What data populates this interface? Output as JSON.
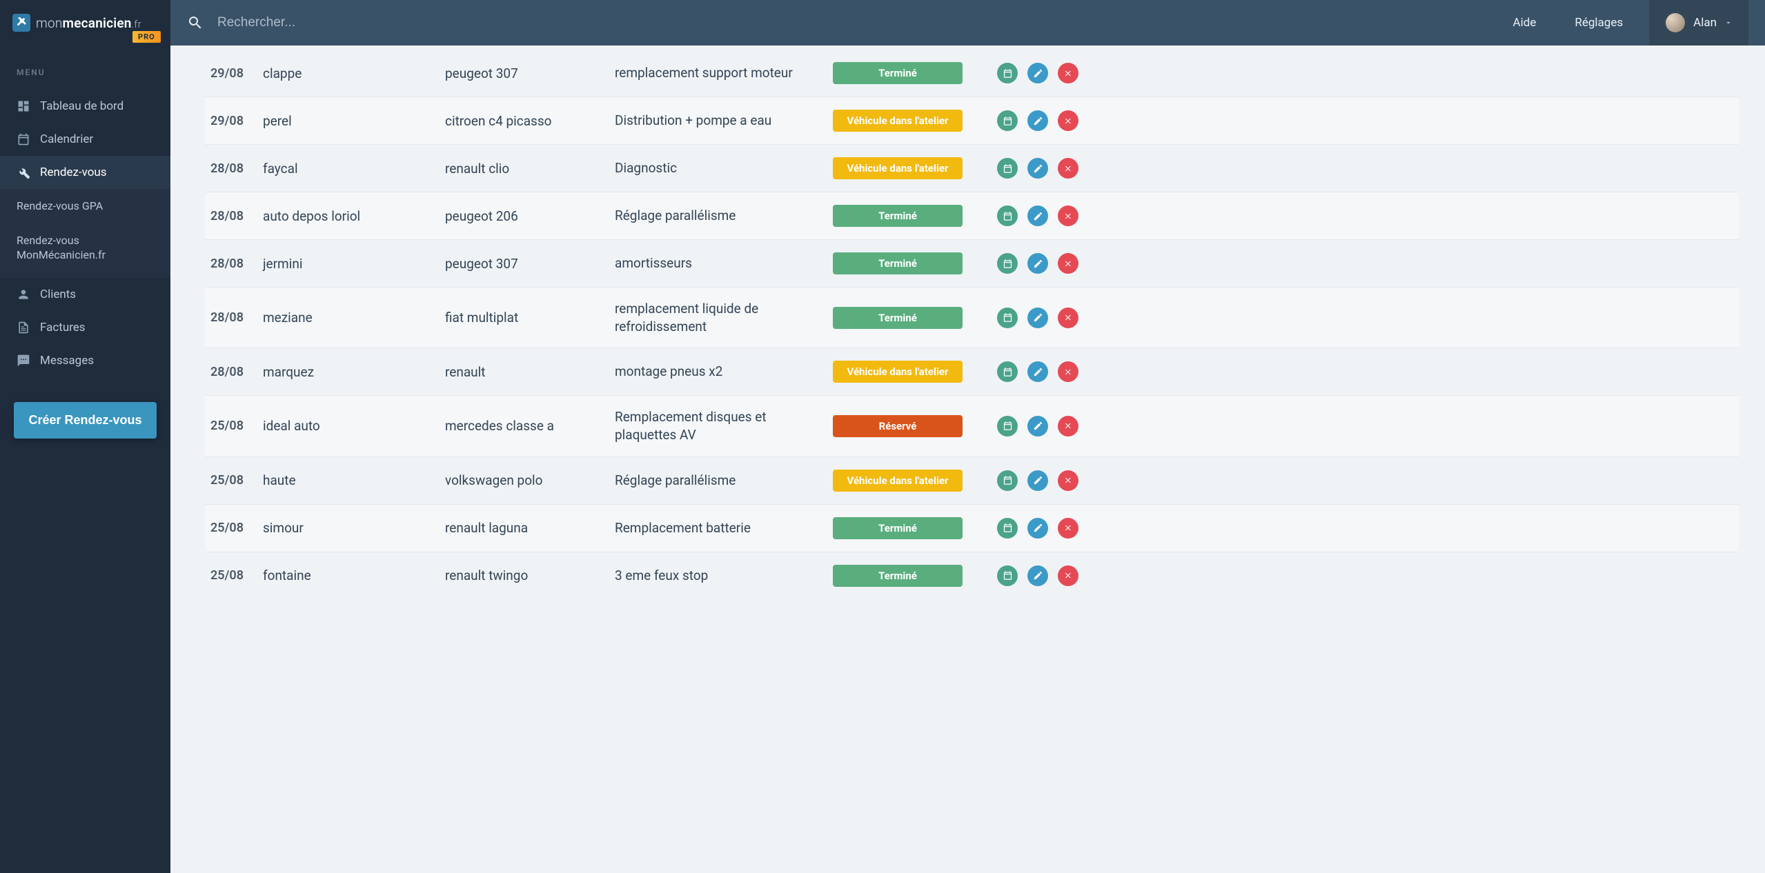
{
  "brand": {
    "mon": "mon",
    "mec": "mecanicien",
    "tld": ".fr",
    "pro": "PRO"
  },
  "sidebar": {
    "menu_label": "MENU",
    "items": [
      {
        "label": "Tableau de bord",
        "icon": "dashboard"
      },
      {
        "label": "Calendrier",
        "icon": "calendar"
      },
      {
        "label": "Rendez-vous",
        "icon": "wrench"
      },
      {
        "label": "Clients",
        "icon": "person"
      },
      {
        "label": "Factures",
        "icon": "file"
      },
      {
        "label": "Messages",
        "icon": "chat"
      }
    ],
    "subitems": [
      {
        "label": "Rendez-vous GPA"
      },
      {
        "label": "Rendez-vous MonMécanicien.fr"
      }
    ],
    "cta": "Créer Rendez-vous"
  },
  "header": {
    "search_placeholder": "Rechercher...",
    "links": [
      "Aide",
      "Réglages"
    ],
    "user": "Alan"
  },
  "status_labels": {
    "green": "Terminé",
    "yellow": "Véhicule dans l'atelier",
    "orange": "Réservé"
  },
  "rows": [
    {
      "date": "29/08",
      "name": "clappe",
      "vehicle": "peugeot 307",
      "desc": "remplacement support moteur",
      "status": "green"
    },
    {
      "date": "29/08",
      "name": "perel",
      "vehicle": "citroen c4 picasso",
      "desc": "Distribution + pompe a eau",
      "status": "yellow"
    },
    {
      "date": "28/08",
      "name": "faycal",
      "vehicle": "renault clio",
      "desc": "Diagnostic",
      "status": "yellow"
    },
    {
      "date": "28/08",
      "name": "auto depos loriol",
      "vehicle": "peugeot 206",
      "desc": "Réglage parallélisme",
      "status": "green"
    },
    {
      "date": "28/08",
      "name": "jermini",
      "vehicle": "peugeot 307",
      "desc": "amortisseurs",
      "status": "green"
    },
    {
      "date": "28/08",
      "name": "meziane",
      "vehicle": "fiat multiplat",
      "desc": "remplacement liquide de refroidissement",
      "status": "green"
    },
    {
      "date": "28/08",
      "name": "marquez",
      "vehicle": "renault",
      "desc": "montage pneus x2",
      "status": "yellow"
    },
    {
      "date": "25/08",
      "name": "ideal auto",
      "vehicle": "mercedes classe a",
      "desc": "Remplacement disques et plaquettes AV",
      "status": "orange"
    },
    {
      "date": "25/08",
      "name": "haute",
      "vehicle": "volkswagen polo",
      "desc": "Réglage parallélisme",
      "status": "yellow"
    },
    {
      "date": "25/08",
      "name": "simour",
      "vehicle": "renault laguna",
      "desc": "Remplacement batterie",
      "status": "green"
    },
    {
      "date": "25/08",
      "name": "fontaine",
      "vehicle": "renault twingo",
      "desc": "3 eme feux stop",
      "status": "green"
    }
  ]
}
